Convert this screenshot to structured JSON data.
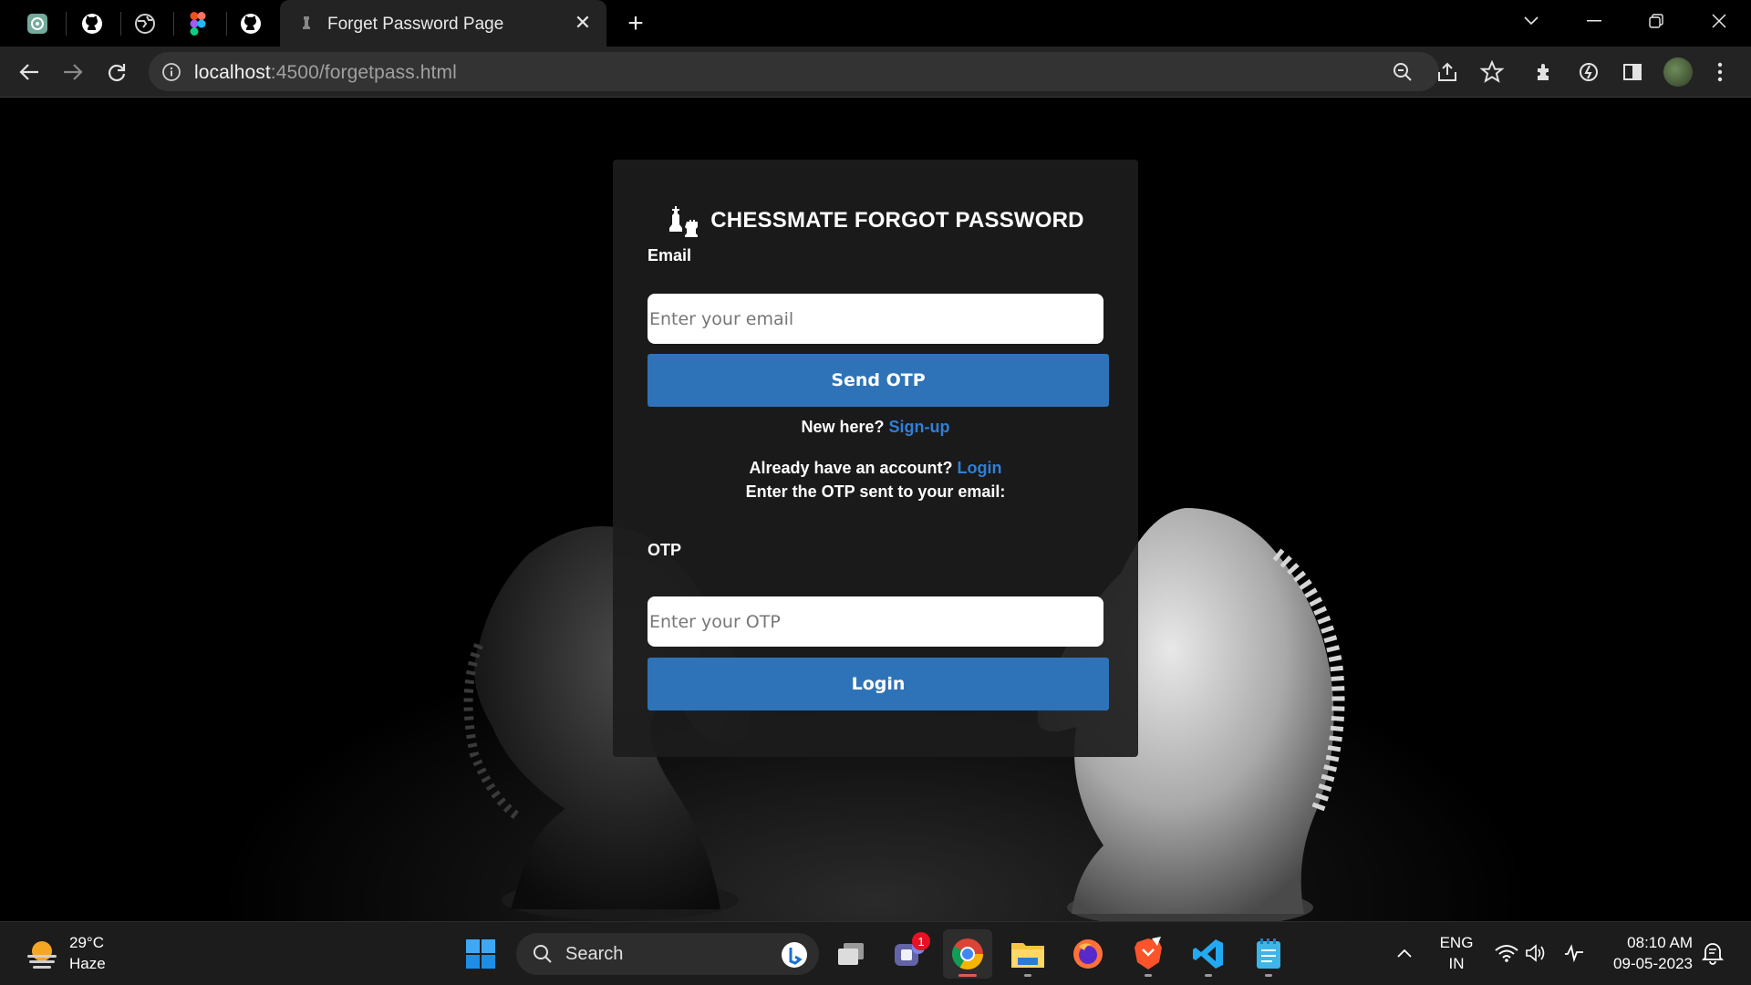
{
  "browser": {
    "active_tab_title": "Forget Password Page",
    "url_host": "localhost",
    "url_path": ":4500/forgetpass.html"
  },
  "card": {
    "title": "CHESSMATE FORGOT PASSWORD",
    "email_label": "Email",
    "email_placeholder": "Enter your email",
    "send_otp_label": "Send OTP",
    "new_here_text": "New here?",
    "signup_link": "Sign-up",
    "already_text": "Already have an account?",
    "login_link": "Login",
    "otp_instruction": "Enter the OTP sent to your email:",
    "otp_label": "OTP",
    "otp_placeholder": "Enter your OTP",
    "login_button_label": "Login"
  },
  "taskbar": {
    "weather_temp": "29°C",
    "weather_condition": "Haze",
    "search_label": "Search",
    "teams_badge": "1",
    "language_line1": "ENG",
    "language_line2": "IN",
    "time": "08:10 AM",
    "date": "09-05-2023"
  },
  "colors": {
    "accent_blue": "#2e73b8",
    "link_blue": "#2f7fd8",
    "card_bg": "#1c1c1c",
    "chrome_bg": "#232323"
  },
  "icons": [
    "chatgpt-icon",
    "github-icon",
    "globe-icon",
    "figma-icon",
    "chess-icon",
    "back-arrow-icon",
    "forward-arrow-icon",
    "reload-icon",
    "info-icon",
    "zoom-icon",
    "share-icon",
    "star-icon",
    "extensions-icon",
    "sync-icon",
    "sidepanel-icon",
    "profile-avatar",
    "menu-icon",
    "windows-start-icon",
    "search-icon",
    "bing-icon",
    "task-view-icon",
    "teams-icon",
    "chrome-icon",
    "file-explorer-icon",
    "firefox-icon",
    "brave-icon",
    "vscode-icon",
    "notepad-icon",
    "chevron-up-icon",
    "wifi-icon",
    "volume-icon",
    "battery-icon",
    "notification-icon"
  ]
}
